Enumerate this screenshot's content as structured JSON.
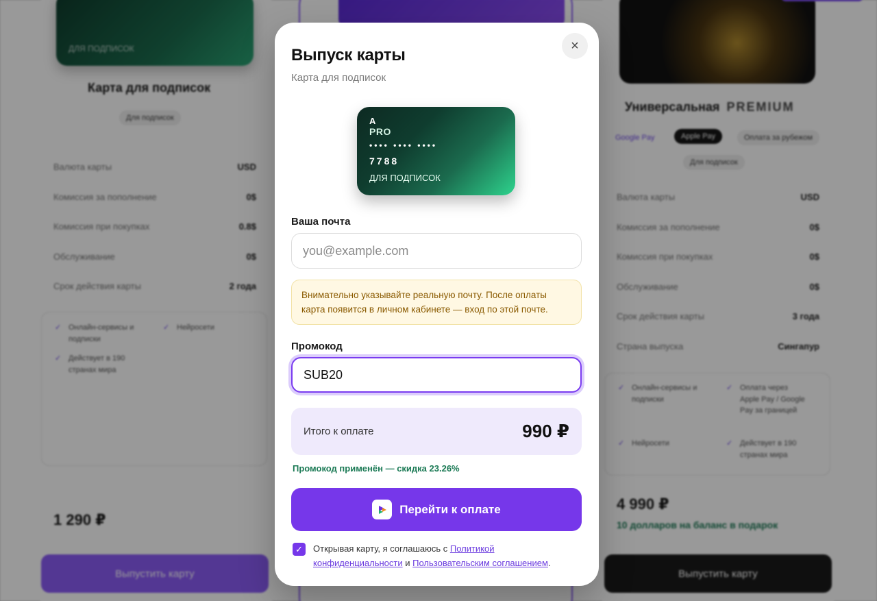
{
  "background": {
    "left_card": {
      "title": "Карта для подписок",
      "chip": "Для подписок",
      "card_label": "ДЛЯ ПОДПИСОК",
      "rows": [
        {
          "label": "Валюта карты",
          "value": "USD"
        },
        {
          "label": "Комиссия за пополнение",
          "value": "0$"
        },
        {
          "label": "Комиссия при покупках",
          "value": "0.8$"
        },
        {
          "label": "Обслуживание",
          "value": "0$"
        },
        {
          "label": "Срок действия карты",
          "value": "2 года"
        }
      ],
      "features": [
        "Онлайн-сервисы и подписки",
        "Нейросети",
        "Действует в 190 странах мира"
      ],
      "price": "1 290 ₽",
      "button": "Выпустить карту"
    },
    "right_card": {
      "title": "Универсальная",
      "title_badge": "PREMIUM",
      "chips": [
        "Google Pay",
        "Apple Pay",
        "Оплата за рубежом",
        "Для подписок"
      ],
      "rows": [
        {
          "label": "Валюта карты",
          "value": "USD"
        },
        {
          "label": "Комиссия за пополнение",
          "value": "0$"
        },
        {
          "label": "Комиссия при покупках",
          "value": "0$"
        },
        {
          "label": "Обслуживание",
          "value": "0$"
        },
        {
          "label": "Срок действия карты",
          "value": "3 года"
        },
        {
          "label": "Страна выпуска",
          "value": "Сингапур"
        }
      ],
      "features": [
        "Онлайн-сервисы и подписки",
        "Оплата через Apple Pay / Google Pay за границей",
        "Нейросети",
        "Действует в 190 странах мира"
      ],
      "price": "4 990 ₽",
      "bonus": "10 долларов на баланс в подарок",
      "button": "Выпустить карту"
    }
  },
  "modal": {
    "title": "Выпуск карты",
    "subtitle": "Карта для подписок",
    "close_symbol": "×",
    "card": {
      "brand_a": "A",
      "brand_pro": "PRO",
      "masked": "•••• •••• ••••",
      "last4": "7788",
      "label": "ДЛЯ ПОДПИСОК"
    },
    "email": {
      "label": "Ваша почта",
      "placeholder": "you@example.com",
      "value": ""
    },
    "warning": "Внимательно указывайте реальную почту. После оплаты карта появится в личном кабинете — вход по этой почте.",
    "promo": {
      "label": "Промокод",
      "value": "SUB20"
    },
    "total": {
      "label": "Итого к оплате",
      "value": "990 ₽"
    },
    "promo_status": "Промокод применён — скидка 23.26%",
    "pay_button": "Перейти к оплате",
    "agreement": {
      "checked": true,
      "prefix": "Открывая карту, я соглашаюсь с ",
      "privacy_link": "Политикой конфиденциальности",
      "middle": " и ",
      "terms_link": "Пользовательским соглашением",
      "suffix": "."
    }
  },
  "colors": {
    "accent": "#7637ea",
    "success": "#1b7a55",
    "warning_text": "#8a5a00",
    "total_bg": "#efeafc"
  }
}
